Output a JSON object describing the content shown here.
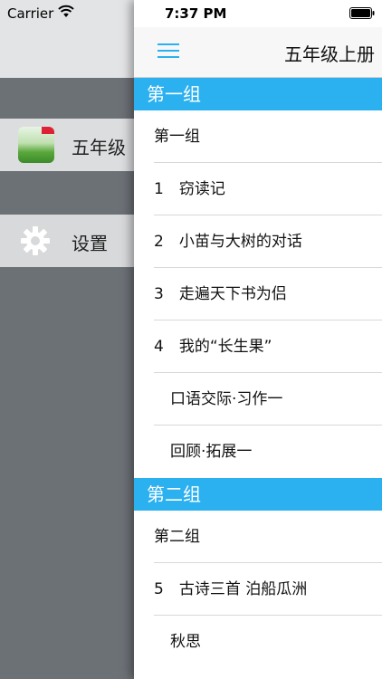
{
  "status_bar": {
    "carrier": "Carrier",
    "time": "7:37 PM"
  },
  "side_menu": {
    "items": [
      {
        "label": "五年级",
        "icon": "book-cover-icon"
      },
      {
        "label": "设置",
        "icon": "gear-icon"
      }
    ]
  },
  "nav": {
    "title": "五年级上册",
    "menu_icon": "hamburger-menu-icon"
  },
  "colors": {
    "section_header": "#2bb0f0",
    "side_background": "#6c7176",
    "nav_accent": "#2bb0f0"
  },
  "sections": [
    {
      "title": "第一组",
      "rows": [
        {
          "text": "第一组",
          "indent": 0
        },
        {
          "text": "1　窃读记",
          "indent": 0
        },
        {
          "text": "2　小苗与大树的对话",
          "indent": 0
        },
        {
          "text": "3　走遍天下书为侣",
          "indent": 0
        },
        {
          "text": "4　我的“长生果”",
          "indent": 0
        },
        {
          "text": "口语交际·习作一",
          "indent": 1
        },
        {
          "text": "回顾·拓展一",
          "indent": 1
        }
      ]
    },
    {
      "title": "第二组",
      "rows": [
        {
          "text": "第二组",
          "indent": 0
        },
        {
          "text": "5　古诗三首 泊船瓜洲",
          "indent": 0
        },
        {
          "text": "秋思",
          "indent": 1
        }
      ]
    }
  ]
}
